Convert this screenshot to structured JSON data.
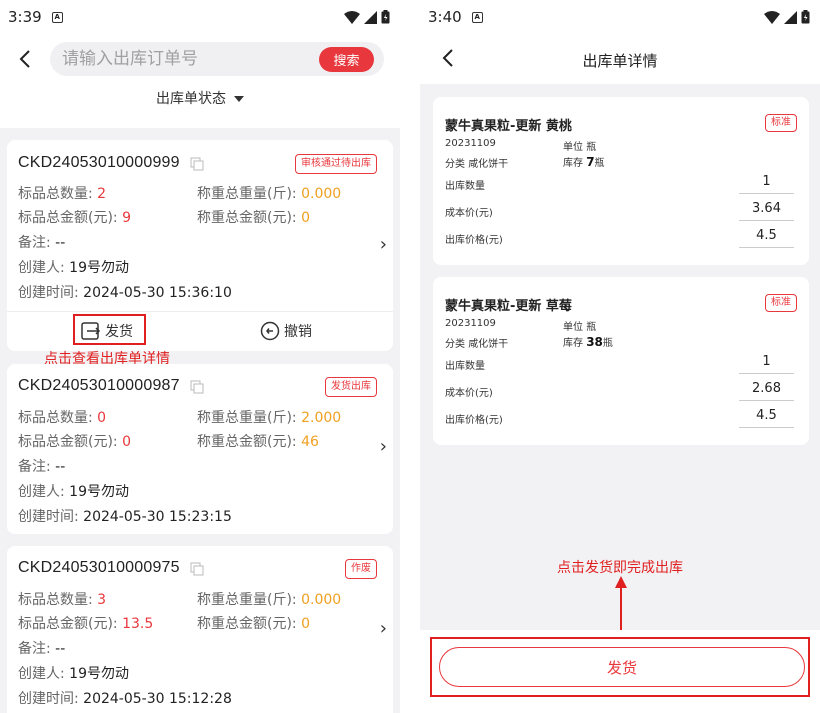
{
  "left": {
    "status_time": "3:39",
    "search_placeholder": "请输入出库订单号",
    "search_button": "搜索",
    "status_filter": "出库单状态",
    "labels": {
      "std_qty": "标品总数量:",
      "weigh_weight": "称重总重量(斤):",
      "std_amount": "标品总金额(元):",
      "weigh_amount": "称重总金额(元):",
      "remark": "备注:",
      "creator": "创建人:",
      "created_time": "创建时间:"
    },
    "orders": [
      {
        "order_no": "CKD24053010000999",
        "tag": "审核通过待出库",
        "std_qty": "2",
        "weigh_weight": "0.000",
        "std_amount": "9",
        "weigh_amount": "0",
        "remark": "--",
        "creator": "19号勿动",
        "created_time": "2024-05-30 15:36:10",
        "action_ship": "发货",
        "action_cancel": "撤销"
      },
      {
        "order_no": "CKD24053010000987",
        "tag": "发货出库",
        "std_qty": "0",
        "weigh_weight": "2.000",
        "std_amount": "0",
        "weigh_amount": "46",
        "remark": "--",
        "creator": "19号勿动",
        "created_time": "2024-05-30 15:23:15"
      },
      {
        "order_no": "CKD24053010000975",
        "tag": "作废",
        "std_qty": "3",
        "weigh_weight": "0.000",
        "std_amount": "13.5",
        "weigh_amount": "0",
        "remark": "--",
        "creator": "19号勿动",
        "created_time": "2024-05-30 15:12:28"
      }
    ],
    "annotation": "点击查看出库单详情"
  },
  "right": {
    "status_time": "3:40",
    "title": "出库单详情",
    "labels": {
      "unit": "单位",
      "category": "分类",
      "stock": "库存",
      "out_qty": "出库数量",
      "cost_price": "成本价(元)",
      "out_price": "出库价格(元)"
    },
    "products": [
      {
        "name": "蒙牛真果粒-更新 黄桃",
        "tag": "标准",
        "code": "20231109",
        "unit": "瓶",
        "category": "咸化饼干",
        "stock_num": "7",
        "stock_unit": "瓶",
        "out_qty": "1",
        "cost_price": "3.64",
        "out_price": "4.5"
      },
      {
        "name": "蒙牛真果粒-更新 草莓",
        "tag": "标准",
        "code": "20231109",
        "unit": "瓶",
        "category": "咸化饼干",
        "stock_num": "38",
        "stock_unit": "瓶",
        "out_qty": "1",
        "cost_price": "2.68",
        "out_price": "4.5"
      }
    ],
    "annotation": "点击发货即完成出库",
    "ship_button": "发货"
  },
  "colors": {
    "accent": "#e8383d",
    "annotation": "#e02020",
    "orange_value": "#f0a020",
    "background": "#f2f2f5"
  }
}
